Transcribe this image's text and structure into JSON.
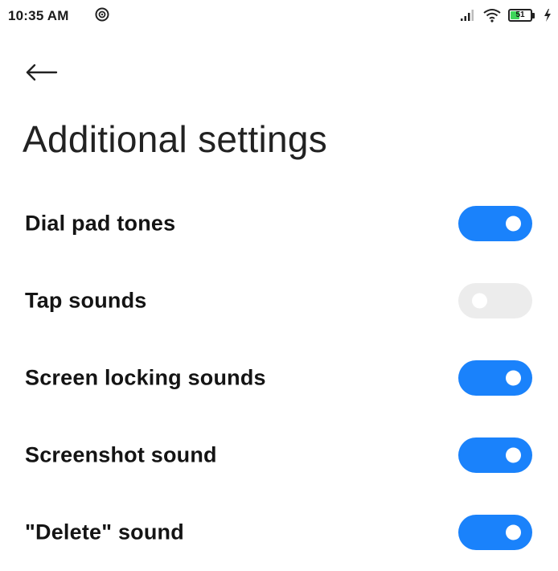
{
  "status_bar": {
    "time": "10:35 AM",
    "left_icon": "hotspot-icon",
    "battery_level": "51",
    "icons": [
      "signal-icon",
      "wifi-icon",
      "battery-icon",
      "charging-bolt-icon"
    ]
  },
  "header": {
    "back_icon": "back-arrow-icon",
    "title": "Additional settings"
  },
  "settings": [
    {
      "label": "Dial pad tones",
      "enabled": true
    },
    {
      "label": "Tap sounds",
      "enabled": false
    },
    {
      "label": "Screen locking sounds",
      "enabled": true
    },
    {
      "label": "Screenshot sound",
      "enabled": true
    },
    {
      "label": "\"Delete\" sound",
      "enabled": true
    }
  ],
  "colors": {
    "toggle_on": "#1a82fb",
    "toggle_off": "#ececec",
    "background": "#ffffff",
    "text": "#141414"
  }
}
